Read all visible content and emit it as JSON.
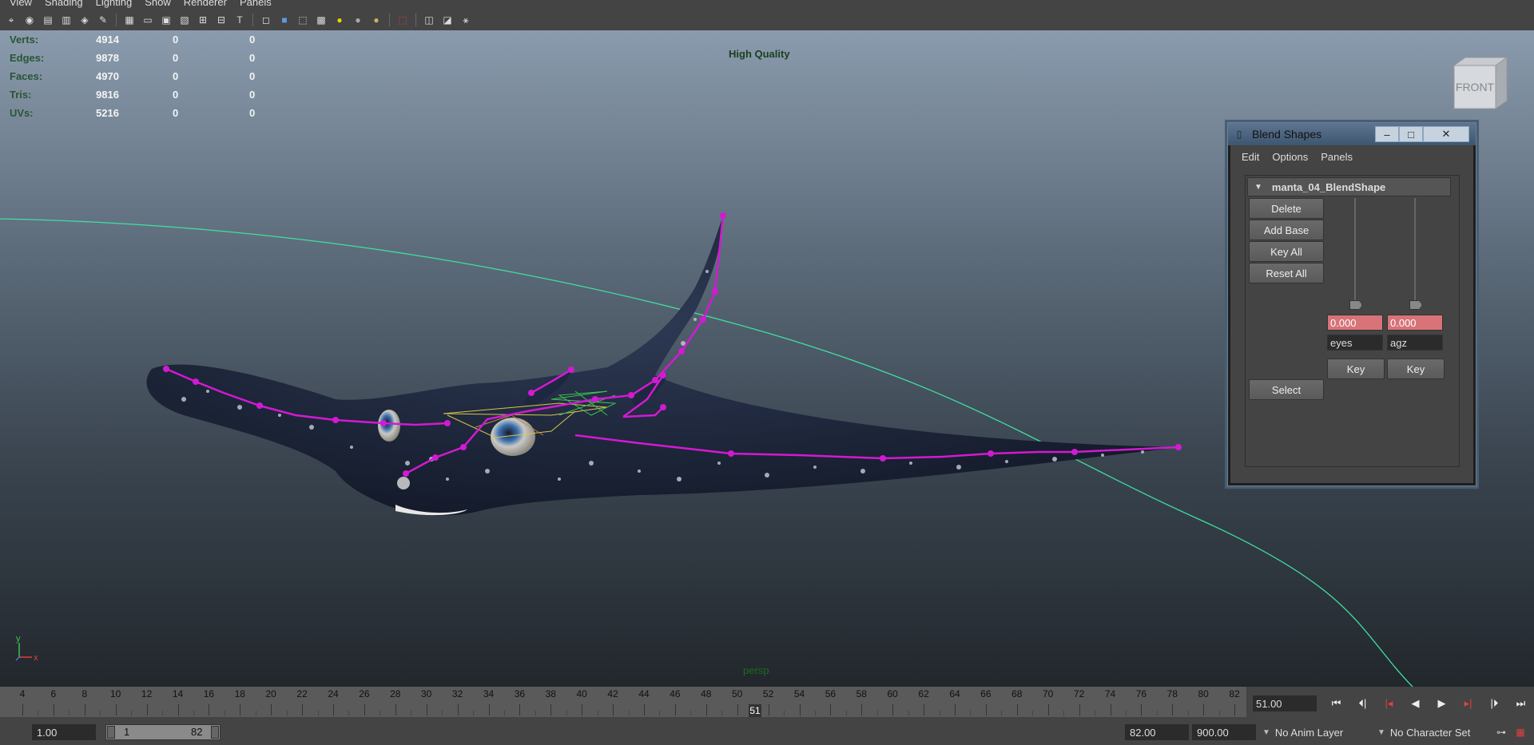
{
  "menu": [
    "View",
    "Shading",
    "Lighting",
    "Show",
    "Renderer",
    "Panels"
  ],
  "stats": [
    {
      "label": "Verts:",
      "values": [
        "4914",
        "0",
        "0"
      ]
    },
    {
      "label": "Edges:",
      "values": [
        "9878",
        "0",
        "0"
      ]
    },
    {
      "label": "Faces:",
      "values": [
        "4970",
        "0",
        "0"
      ]
    },
    {
      "label": "Tris:",
      "values": [
        "9816",
        "0",
        "0"
      ]
    },
    {
      "label": "UVs:",
      "values": [
        "5216",
        "0",
        "0"
      ]
    }
  ],
  "viewport": {
    "quality": "High Quality",
    "camera": "persp",
    "viewcube_face": "FRONT",
    "axis_y": "y",
    "axis_x": "x"
  },
  "blend_shapes": {
    "title": "Blend Shapes",
    "menu": [
      "Edit",
      "Options",
      "Panels"
    ],
    "node": "manta_04_BlendShape",
    "buttons": {
      "delete": "Delete",
      "add_base": "Add Base",
      "key_all": "Key All",
      "reset_all": "Reset All",
      "select": "Select"
    },
    "targets": [
      {
        "name": "eyes",
        "value": "0.000",
        "key": "Key"
      },
      {
        "name": "agz",
        "value": "0.000",
        "key": "Key"
      }
    ]
  },
  "timeline": {
    "ticks": [
      "4",
      "6",
      "8",
      "10",
      "12",
      "14",
      "16",
      "18",
      "20",
      "22",
      "24",
      "26",
      "28",
      "30",
      "32",
      "34",
      "36",
      "38",
      "40",
      "42",
      "44",
      "46",
      "48",
      "50",
      "52",
      "54",
      "56",
      "58",
      "60",
      "62",
      "64",
      "66",
      "68",
      "70",
      "72",
      "74",
      "76",
      "78",
      "80",
      "82"
    ],
    "current_frame_marker": "51",
    "current_time": "51.00"
  },
  "range": {
    "start_time": "1.00",
    "range_start": "1",
    "range_end": "82",
    "end_time": "82.00",
    "anim_end": "900.00",
    "anim_layer": "No Anim Layer",
    "character_set": "No Character Set"
  },
  "colors": {
    "stats_label": "#2a5534",
    "joint": "#d21ad2",
    "motion_path": "#3fe0a0",
    "field_keyed": "#d87378"
  }
}
